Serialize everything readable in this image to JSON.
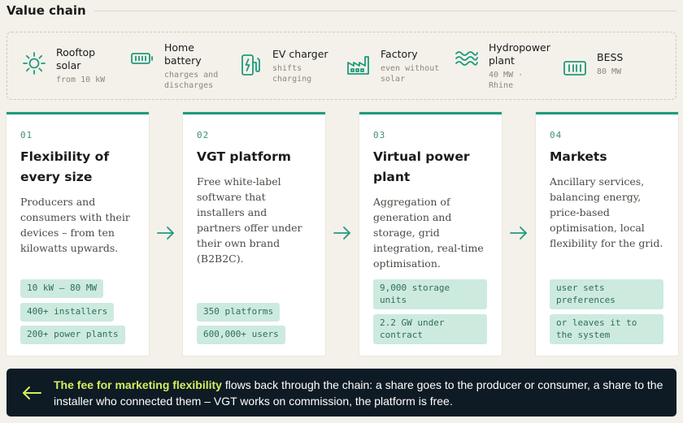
{
  "header": {
    "title": "Value chain"
  },
  "devices": [
    {
      "icon": "sun-icon",
      "name": "Rooftop solar",
      "sub": "from 10 kW"
    },
    {
      "icon": "battery-icon",
      "name": "Home battery",
      "sub": "charges and discharges"
    },
    {
      "icon": "ev-charger-icon",
      "name": "EV charger",
      "sub": "shifts charging"
    },
    {
      "icon": "factory-icon",
      "name": "Factory",
      "sub": "even without solar"
    },
    {
      "icon": "water-waves-icon",
      "name": "Hydropower plant",
      "sub": "40 MW · Rhine"
    },
    {
      "icon": "storage-rack-icon",
      "name": "BESS",
      "sub": "80 MW"
    }
  ],
  "stages": [
    {
      "num": "01",
      "title": "Flexibility of every size",
      "desc": "Producers and consumers with their devices – from ten kilowatts upwards.",
      "tags": [
        "10 kW – 80 MW",
        "400+ installers",
        "200+ power plants"
      ]
    },
    {
      "num": "02",
      "title": "VGT platform",
      "desc": "Free white-label software that installers and partners offer under their own brand (B2B2C).",
      "tags": [
        "350 platforms",
        "600,000+ users"
      ]
    },
    {
      "num": "03",
      "title": "Virtual power plant",
      "desc": "Aggregation of generation and storage, grid integration, real-time optimisation.",
      "tags": [
        "9,000 storage units",
        "2.2 GW under contract"
      ]
    },
    {
      "num": "04",
      "title": "Markets",
      "desc": "Ancillary services, balancing energy, price-based optimisation, local flexibility for the grid.",
      "tags": [
        "user sets preferences",
        "or leaves it to the system"
      ]
    }
  ],
  "footer": {
    "highlight": "The fee for marketing flexibility",
    "text": " flows back through the chain: a share goes to the producer or consumer, a share to the installer who connected them – VGT works on commission, the platform is free."
  },
  "colors": {
    "accent": "#1f9a7e",
    "chip_bg": "#cdeadf",
    "footer_bg": "#0e1b25",
    "footer_highlight": "#d3ef5c"
  }
}
